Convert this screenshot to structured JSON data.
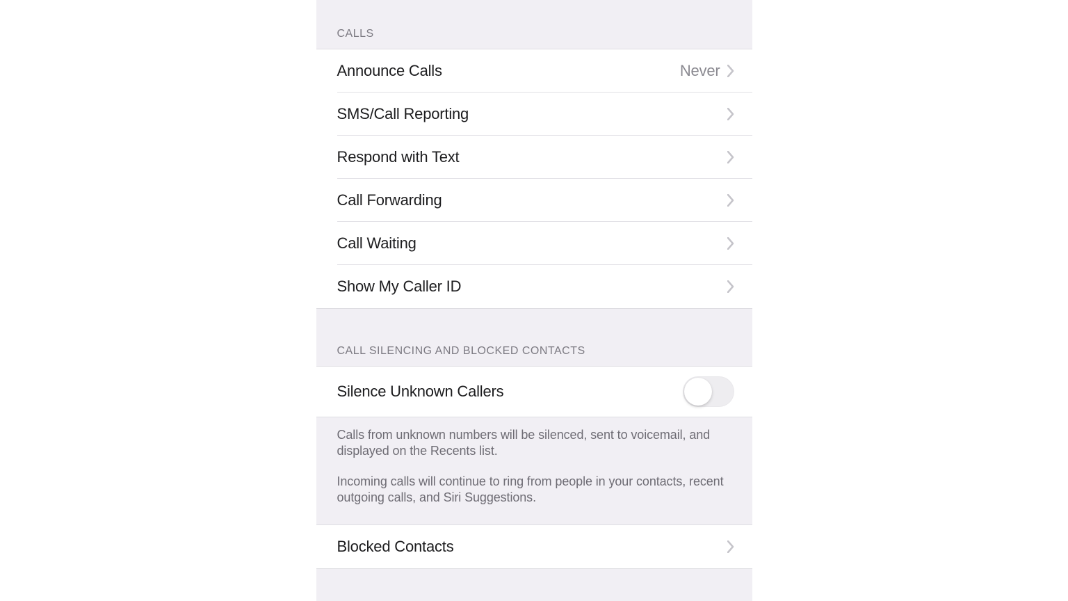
{
  "sections": {
    "calls": {
      "header": "CALLS",
      "items": [
        {
          "label": "Announce Calls",
          "value": "Never"
        },
        {
          "label": "SMS/Call Reporting"
        },
        {
          "label": "Respond with Text"
        },
        {
          "label": "Call Forwarding"
        },
        {
          "label": "Call Waiting"
        },
        {
          "label": "Show My Caller ID"
        }
      ]
    },
    "silencing": {
      "header": "CALL SILENCING AND BLOCKED CONTACTS",
      "toggle": {
        "label": "Silence Unknown Callers",
        "on": false
      },
      "footer1": "Calls from unknown numbers will be silenced, sent to voicemail, and displayed on the Recents list.",
      "footer2": "Incoming calls will continue to ring from people in your contacts, recent outgoing calls, and Siri Suggestions.",
      "blocked": {
        "label": "Blocked Contacts"
      }
    }
  }
}
